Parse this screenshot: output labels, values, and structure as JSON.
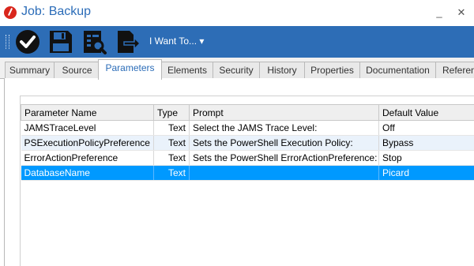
{
  "window": {
    "title": "Job: Backup",
    "minimize": "_",
    "close": "✕"
  },
  "toolbar": {
    "buttons": [
      "check-icon",
      "save-icon",
      "report-icon",
      "export-icon"
    ],
    "i_want_to": "I Want To... ▾",
    "background": "#2d6db6"
  },
  "tabs": [
    "Summary",
    "Source",
    "Parameters",
    "Elements",
    "Security",
    "History",
    "Properties",
    "Documentation",
    "References"
  ],
  "active_tab": "Parameters",
  "table": {
    "headers": [
      "Parameter Name",
      "Type",
      "Prompt",
      "Default Value"
    ],
    "rows": [
      {
        "name": "JAMSTraceLevel",
        "type": "Text",
        "prompt": "Select the JAMS Trace Level:",
        "default": "Off"
      },
      {
        "name": "PSExecutionPolicyPreference",
        "type": "Text",
        "prompt": "Sets the PowerShell Execution Policy:",
        "default": "Bypass"
      },
      {
        "name": "ErrorActionPreference",
        "type": "Text",
        "prompt": "Sets the PowerShell ErrorActionPreference:",
        "default": "Stop"
      },
      {
        "name": "DatabaseName",
        "type": "Text",
        "prompt": "",
        "default": "Picard"
      }
    ],
    "selected_row": 3,
    "selection_color": "#0099ff"
  }
}
